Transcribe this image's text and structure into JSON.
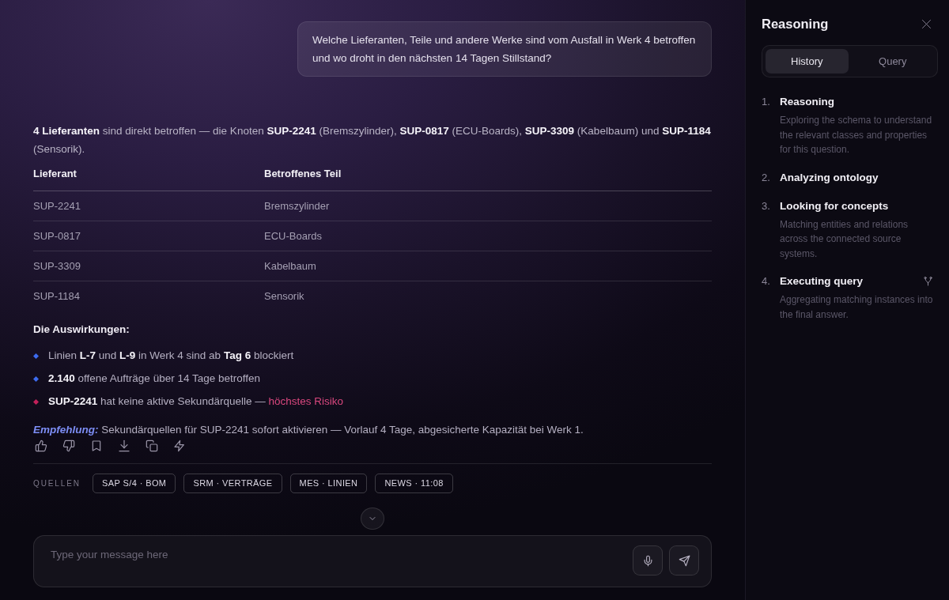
{
  "conversation": {
    "user_message": "Welche Lieferanten, Teile und andere Werke sind vom Ausfall in Werk 4 betroffen und wo droht in den nächsten 14 Tagen Stillstand?",
    "answer": {
      "summary": "**4 Lieferanten** sind direkt betroffen — die Knoten **SUP-2241** (Bremszylinder), **SUP-0817** (ECU-Boards), **SUP-3309** (Kabelbaum) und **SUP-1184** (Sensorik).",
      "table": {
        "columns": [
          "Lieferant",
          "Betroffenes Teil"
        ],
        "rows": [
          [
            "SUP-2241",
            "Bremszylinder"
          ],
          [
            "SUP-0817",
            "ECU-Boards"
          ],
          [
            "SUP-3309",
            "Kabelbaum"
          ],
          [
            "SUP-1184",
            "Sensorik"
          ]
        ]
      },
      "impacts_heading": "Die Auswirkungen:",
      "impacts": [
        {
          "text": "Linien **L-7** und **L-9** in Werk 4 sind ab **Tag 6** blockiert",
          "color": "#3d6cf0"
        },
        {
          "text": "**2.140** offene Aufträge über 14 Tage betroffen",
          "color": "#3d6cf0"
        },
        {
          "text": "**SUP-2241** hat keine aktive Sekundärquelle —",
          "highlight": "höchstes Risiko",
          "color": "#c4205a"
        }
      ],
      "recommendation": {
        "label": "Empfehlung:",
        "text": "Sekundärquellen für SUP-2241 sofort aktivieren — Vorlauf 4 Tage, abgesicherte Kapazität bei Werk 1."
      },
      "sources_label": "QUELLEN",
      "sources": [
        "SAP S/4 · BOM",
        "SRM · VERTRÄGE",
        "MES · LINIEN",
        "NEWS · 11:08"
      ]
    }
  },
  "composer": {
    "placeholder": "Type your message here"
  },
  "reasoning_panel": {
    "title": "Reasoning",
    "tabs": [
      {
        "label": "History",
        "selected": true
      },
      {
        "label": "Query",
        "selected": false
      }
    ],
    "steps": [
      {
        "number": "1.",
        "title": "Reasoning",
        "description": "Exploring the schema to understand the relevant classes and properties for this question.",
        "active": false
      },
      {
        "number": "2.",
        "title": "Analyzing ontology",
        "active": false
      },
      {
        "number": "3.",
        "title": "Looking for concepts",
        "description": "Matching entities and relations across the connected source systems.",
        "active": false
      },
      {
        "number": "4.",
        "title": "Executing query",
        "description": "Aggregating matching instances into the final answer.",
        "active": true
      }
    ]
  }
}
